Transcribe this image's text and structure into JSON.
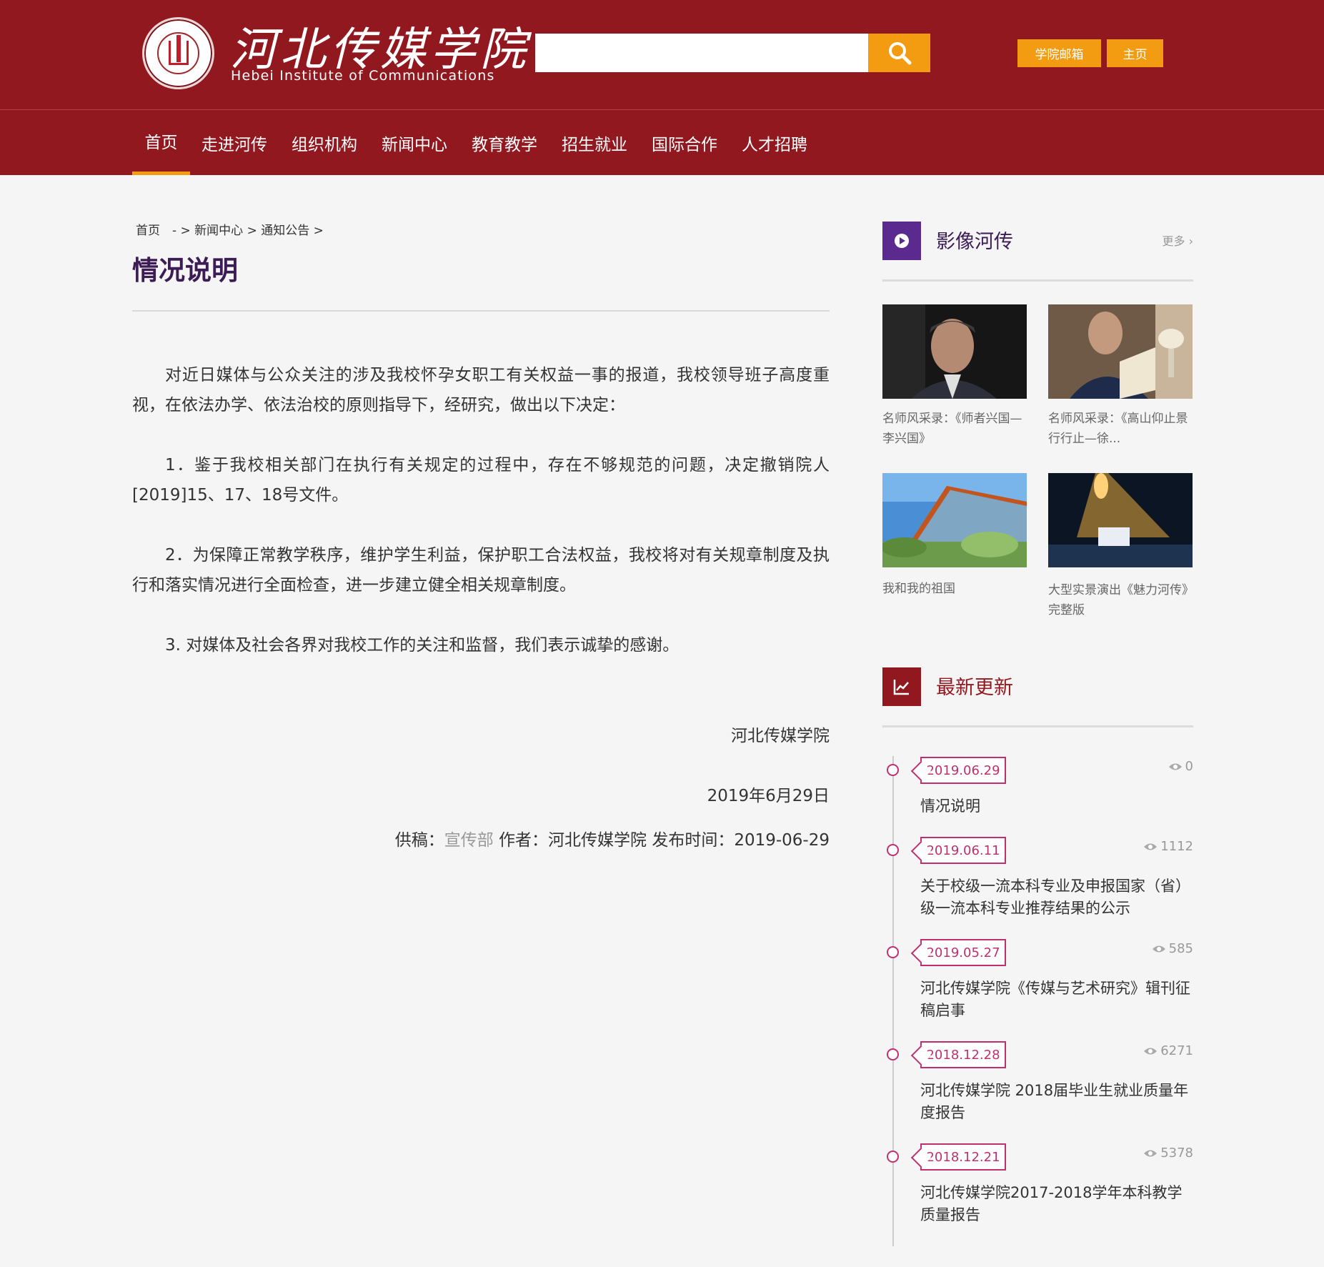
{
  "colors": {
    "primary": "#92181f",
    "accent": "#f39c12",
    "title_purple": "#3d1b55",
    "timeline_pink": "#c0306f"
  },
  "header": {
    "logo_cn": "河北传媒学院",
    "logo_en": "Hebei Institute of Communications",
    "search_placeholder": "",
    "links": [
      "学院邮箱",
      "主页"
    ]
  },
  "nav": {
    "items": [
      "首页",
      "走进河传",
      "组织机构",
      "新闻中心",
      "教育教学",
      "招生就业",
      "国际合作",
      "人才招聘"
    ],
    "active": "首页"
  },
  "breadcrumb": "首页　- > 新闻中心 > 通知公告 >",
  "article": {
    "title": "情况说明",
    "paragraphs": [
      "对近日媒体与公众关注的涉及我校怀孕女职工有关权益一事的报道，我校领导班子高度重视，在依法办学、依法治校的原则指导下，经研究，做出以下决定：",
      "1．鉴于我校相关部门在执行有关规定的过程中，存在不够规范的问题，决定撤销院人[2019]15、17、18号文件。",
      "2．为保障正常教学秩序，维护学生利益，保护职工合法权益，我校将对有关规章制度及执行和落实情况进行全面检查，进一步建立健全相关规章制度。",
      "3. 对媒体及社会各界对我校工作的关注和监督，我们表示诚挚的感谢。"
    ],
    "signature": "河北传媒学院",
    "date": "2019年6月29日",
    "meta": {
      "source_label": "供稿：",
      "source": "宣传部",
      "author_label": " 作者：",
      "author": "河北传媒学院",
      "time_label": " 发布时间：",
      "time": "2019-06-29"
    }
  },
  "sidebar": {
    "gallery": {
      "title": "影像河传",
      "more": "更多 ›",
      "items": [
        {
          "caption": "名师风采录：《师者兴国—李兴国》"
        },
        {
          "caption": "名师风采录：《高山仰止景行行止—徐..."
        },
        {
          "caption": "我和我的祖国"
        },
        {
          "caption": "大型实景演出《魅力河传》完整版"
        }
      ]
    },
    "updates": {
      "title": "最新更新",
      "items": [
        {
          "date": "2019.06.29",
          "views": "0",
          "text": "情况说明"
        },
        {
          "date": "2019.06.11",
          "views": "1112",
          "text": "关于校级一流本科专业及申报国家（省）级一流本科专业推荐结果的公示"
        },
        {
          "date": "2019.05.27",
          "views": "585",
          "text": "河北传媒学院《传媒与艺术研究》辑刊征稿启事"
        },
        {
          "date": "2018.12.28",
          "views": "6271",
          "text": "河北传媒学院 2018届毕业生就业质量年度报告"
        },
        {
          "date": "2018.12.21",
          "views": "5378",
          "text": "河北传媒学院2017-2018学年本科教学质量报告"
        }
      ]
    }
  }
}
